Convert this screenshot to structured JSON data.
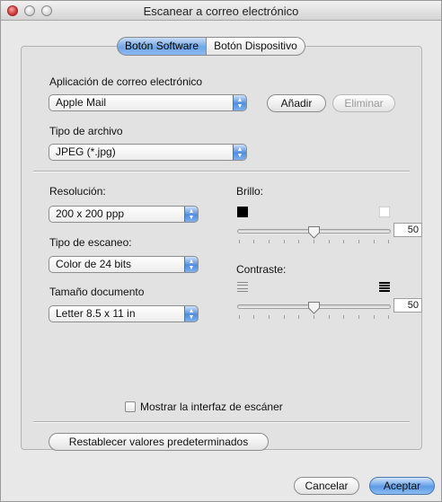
{
  "window": {
    "title": "Escanear a correo electrónico"
  },
  "tabs": [
    {
      "label": "Botón Software",
      "selected": true
    },
    {
      "label": "Botón Dispositivo",
      "selected": false
    }
  ],
  "email_app": {
    "label": "Aplicación de correo electrónico",
    "value": "Apple Mail",
    "add_label": "Añadir",
    "remove_label": "Eliminar",
    "remove_enabled": false
  },
  "file_type": {
    "label": "Tipo de archivo",
    "value": "JPEG (*.jpg)"
  },
  "resolution": {
    "label": "Resolución:",
    "value": "200 x 200 ppp"
  },
  "scan_type": {
    "label": "Tipo de escaneo:",
    "value": "Color de 24 bits"
  },
  "doc_size": {
    "label": "Tamaño documento",
    "value": "Letter  8.5 x 11 in"
  },
  "brightness": {
    "label": "Brillo:",
    "value": "50",
    "min": 0,
    "max": 100
  },
  "contrast": {
    "label": "Contraste:",
    "value": "50",
    "min": 0,
    "max": 100
  },
  "show_interface": {
    "label": "Mostrar la interfaz de escáner",
    "checked": false
  },
  "restore_defaults_label": "Restablecer valores predeterminados",
  "buttons": {
    "cancel": "Cancelar",
    "accept": "Aceptar"
  },
  "colors": {
    "accent_blue": "#5d9ae6",
    "close_red": "#d33b3b"
  }
}
